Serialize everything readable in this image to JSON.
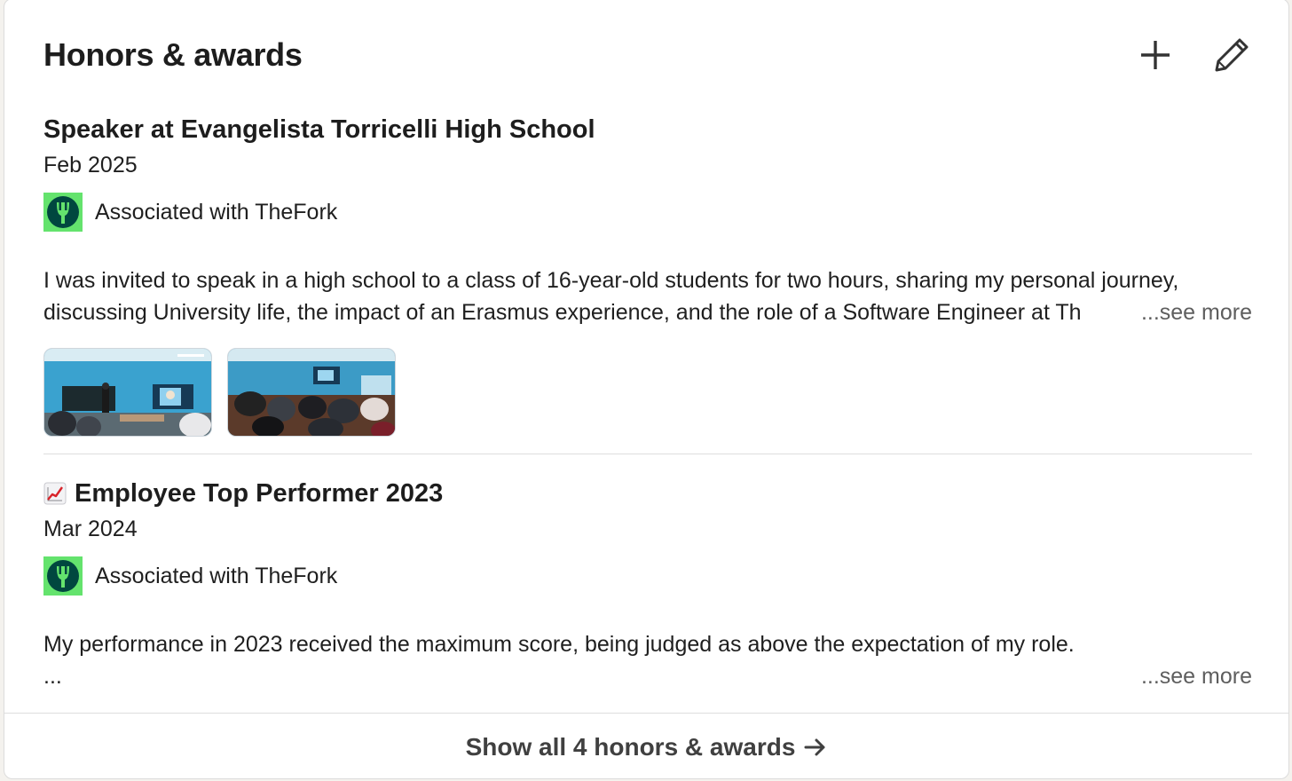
{
  "section": {
    "title": "Honors & awards",
    "add_icon": "plus-icon",
    "edit_icon": "pencil-icon"
  },
  "entries": [
    {
      "title": "Speaker at Evangelista Torricelli High School",
      "date": "Feb 2025",
      "association": "Associated with TheFork",
      "association_logo": "thefork-logo",
      "description_lines": [
        "I was invited to speak in a high school to a class of 16-year-old students for two hours, sharing my personal journey,",
        "discussing University life, the impact of an Erasmus experience, and the role of a Software Engineer at Th"
      ],
      "see_more": "...see more",
      "media": [
        "classroom-photo-1",
        "classroom-photo-2"
      ]
    },
    {
      "emoji": "chart-increasing-icon",
      "title": "Employee Top Performer 2023",
      "date": "Mar 2024",
      "association": "Associated with TheFork",
      "association_logo": "thefork-logo",
      "description_lines": [
        "My performance in 2023 received the maximum score, being judged as above the expectation of my role.",
        "..."
      ],
      "see_more": "...see more"
    }
  ],
  "footer": {
    "label": "Show all 4 honors & awards",
    "arrow_icon": "arrow-right-icon"
  },
  "colors": {
    "thefork_green": "#64e36d",
    "thefork_dark": "#00473f"
  }
}
